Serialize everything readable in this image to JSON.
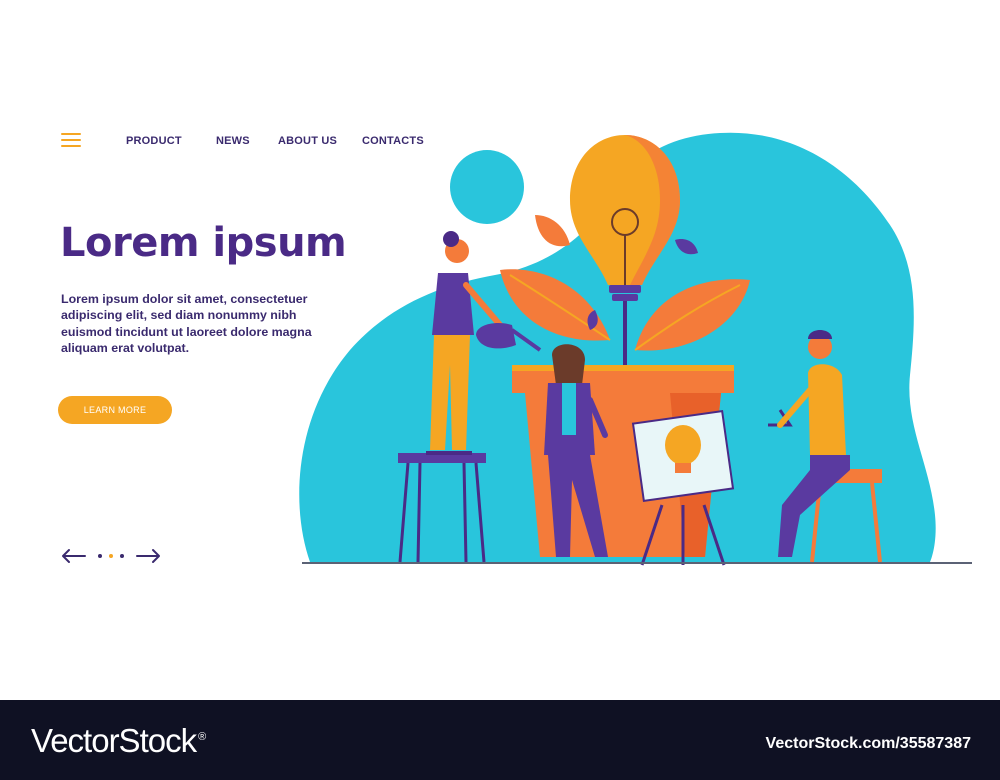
{
  "nav": {
    "items": [
      {
        "label": "PRODUCT"
      },
      {
        "label": "NEWS"
      },
      {
        "label": "ABOUT US"
      },
      {
        "label": "CONTACTS"
      }
    ]
  },
  "hero": {
    "title": "Lorem ipsum",
    "text": "Lorem ipsum dolor sit amet, consectetuer adipiscing elit, sed diam nonummy nibh euismod tincidunt ut laoreet dolore magna aliquam erat volutpat.",
    "button_label": "LEARN MORE"
  },
  "pager": {
    "dots": 3,
    "active_dot": 2
  },
  "colors": {
    "accent": "#f5a623",
    "text_primary": "#3a2a6e",
    "title": "#4a2a86",
    "blob": "#29c5dc",
    "pot": "#f47b3a",
    "footer_bg": "#0f1123"
  },
  "icons": {
    "menu": "hamburger-icon",
    "prev": "arrow-left-icon",
    "next": "arrow-right-icon"
  },
  "footer": {
    "logo": "VectorStock",
    "logo_mark": "®",
    "id": "VectorStock.com/35587387"
  }
}
